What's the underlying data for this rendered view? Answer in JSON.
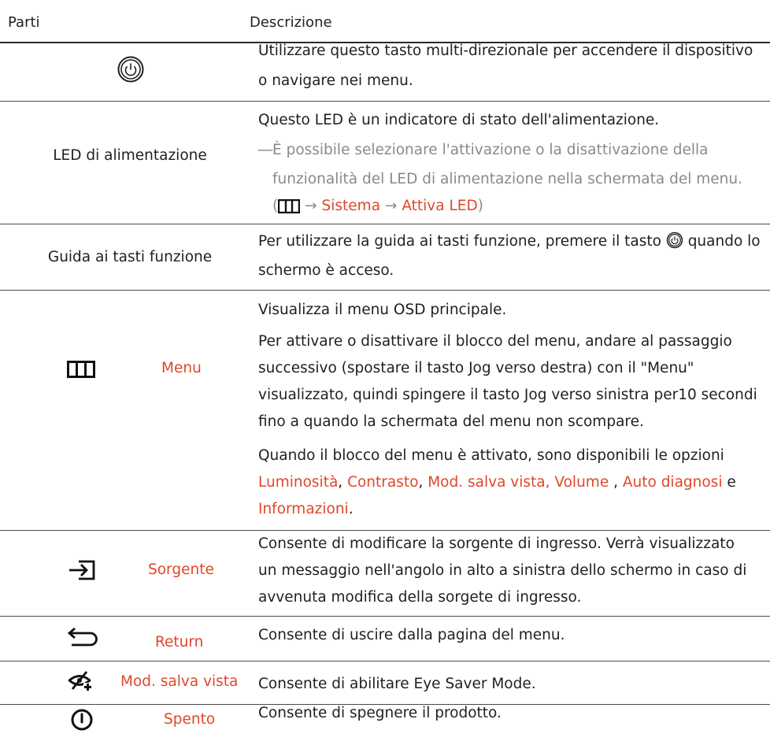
{
  "header": {
    "parts": "Parti",
    "description": "Descrizione"
  },
  "rows": [
    {
      "part_icon": "jog-power-button-icon",
      "desc_lines": [
        "Utilizzare questo tasto multi-direzionale per accendere il dispositivo",
        "o navigare nei menu."
      ]
    },
    {
      "part_label": "LED di alimentazione",
      "desc_lines": [
        "Questo LED è un indicatore di stato dell'alimentazione."
      ],
      "note_dash": "―",
      "note_lines": [
        "È possibile selezionare l'attivazione o la disattivazione della",
        "funzionalità del LED di alimentazione nella schermata del menu."
      ],
      "path": {
        "open": "(",
        "menu_icon": "menu-icon",
        "arrow1": "→",
        "item1": "Sistema",
        "arrow2": "→",
        "item2": "Attiva LED",
        "close": ")"
      }
    },
    {
      "part_label": "Guida ai tasti funzione",
      "desc_pre": "Per utilizzare la guida ai tasti funzione, premere il tasto ",
      "desc_icon": "jog-power-button-icon",
      "desc_post": " quando lo",
      "desc_line2": "schermo è acceso."
    },
    {
      "part_icon": "menu-icon",
      "part_label": "Menu",
      "desc_p1": "Visualizza il menu OSD principale.",
      "desc_p2": [
        "Per attivare o disattivare il blocco del menu, andare al passaggio",
        "successivo (spostare il tasto Jog verso destra) con il \"Menu\"",
        "visualizzato, quindi spingere il tasto Jog verso sinistra per10 secondi",
        "fino a quando la schermata del menu non scompare."
      ],
      "desc_p3_line1": "Quando il blocco del menu è attivato, sono disponibili le opzioni",
      "options": [
        "Luminosità",
        "Contrasto",
        "Mod. salva vista",
        "Volume",
        "Auto diagnosi",
        "Informazioni"
      ],
      "sep_comma": ",",
      "sep_comma_space": " ,",
      "and_word": "e",
      "final_period": "."
    },
    {
      "part_icon": "source-icon",
      "part_label": "Sorgente",
      "desc_lines": [
        "Consente di modificare la sorgente di ingresso. Verrà visualizzato",
        "un messaggio nell'angolo in alto a sinistra dello schermo in caso di",
        "avvenuta modifica della sorgete di ingresso."
      ]
    },
    {
      "part_icon": "return-icon",
      "part_label": "Return",
      "desc_lines": [
        "Consente di uscire dalla pagina del menu."
      ]
    },
    {
      "part_icon": "eye-saver-icon",
      "part_label": "Mod. salva vista",
      "desc_lines": [
        "Consente di abilitare Eye Saver Mode."
      ]
    },
    {
      "part_icon": "power-off-icon",
      "part_label": "Spento",
      "desc_lines": [
        "Consente di spegnere il prodotto."
      ]
    }
  ],
  "colors": {
    "accent": "#e0472a",
    "note": "#8a8a8a",
    "rule": "#4a4a4a"
  }
}
